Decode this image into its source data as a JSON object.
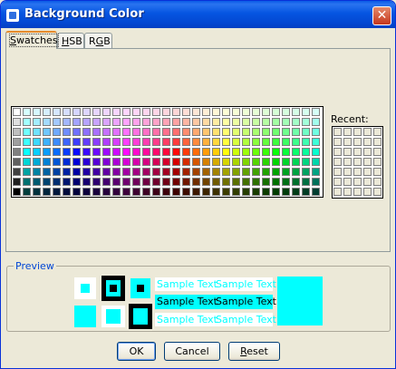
{
  "window": {
    "title": "Background Color",
    "close_glyph": "✕"
  },
  "tabs": [
    {
      "label_pre": "",
      "mnemonic": "S",
      "label_post": "watches",
      "selected": true
    },
    {
      "label_pre": "",
      "mnemonic": "H",
      "label_post": "SB",
      "selected": false
    },
    {
      "label_pre": "R",
      "mnemonic": "G",
      "label_post": "B",
      "selected": false
    }
  ],
  "recent_label": "Recent:",
  "preview": {
    "legend": "Preview",
    "sample_text": "Sample Text",
    "selected_color": "#00ffff"
  },
  "buttons": {
    "ok": "OK",
    "cancel": "Cancel",
    "reset_mnemonic": "R",
    "reset_rest": "eset"
  }
}
